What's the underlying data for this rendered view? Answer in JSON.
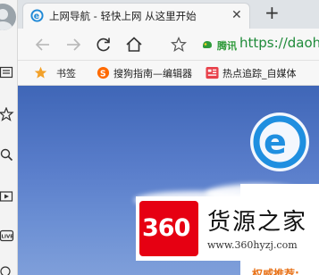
{
  "tab": {
    "title": "上网导航 - 轻快上网 从这里开始"
  },
  "address_bar": {
    "brand": "腾讯",
    "url": "https://daohang."
  },
  "bookmarks": [
    {
      "label": "书签"
    },
    {
      "label": "搜狗指南—编辑器"
    },
    {
      "label": "热点追踪_自媒体"
    }
  ],
  "content": {
    "panel_text": "权威推荐:"
  },
  "watermark": {
    "logo_text": "360",
    "name": "货源之家",
    "url": "www.360hyzj.com"
  },
  "colors": {
    "accent_green": "#1f8b3a",
    "page_blue": "#4a72c2",
    "watermark_red": "#e60012"
  }
}
